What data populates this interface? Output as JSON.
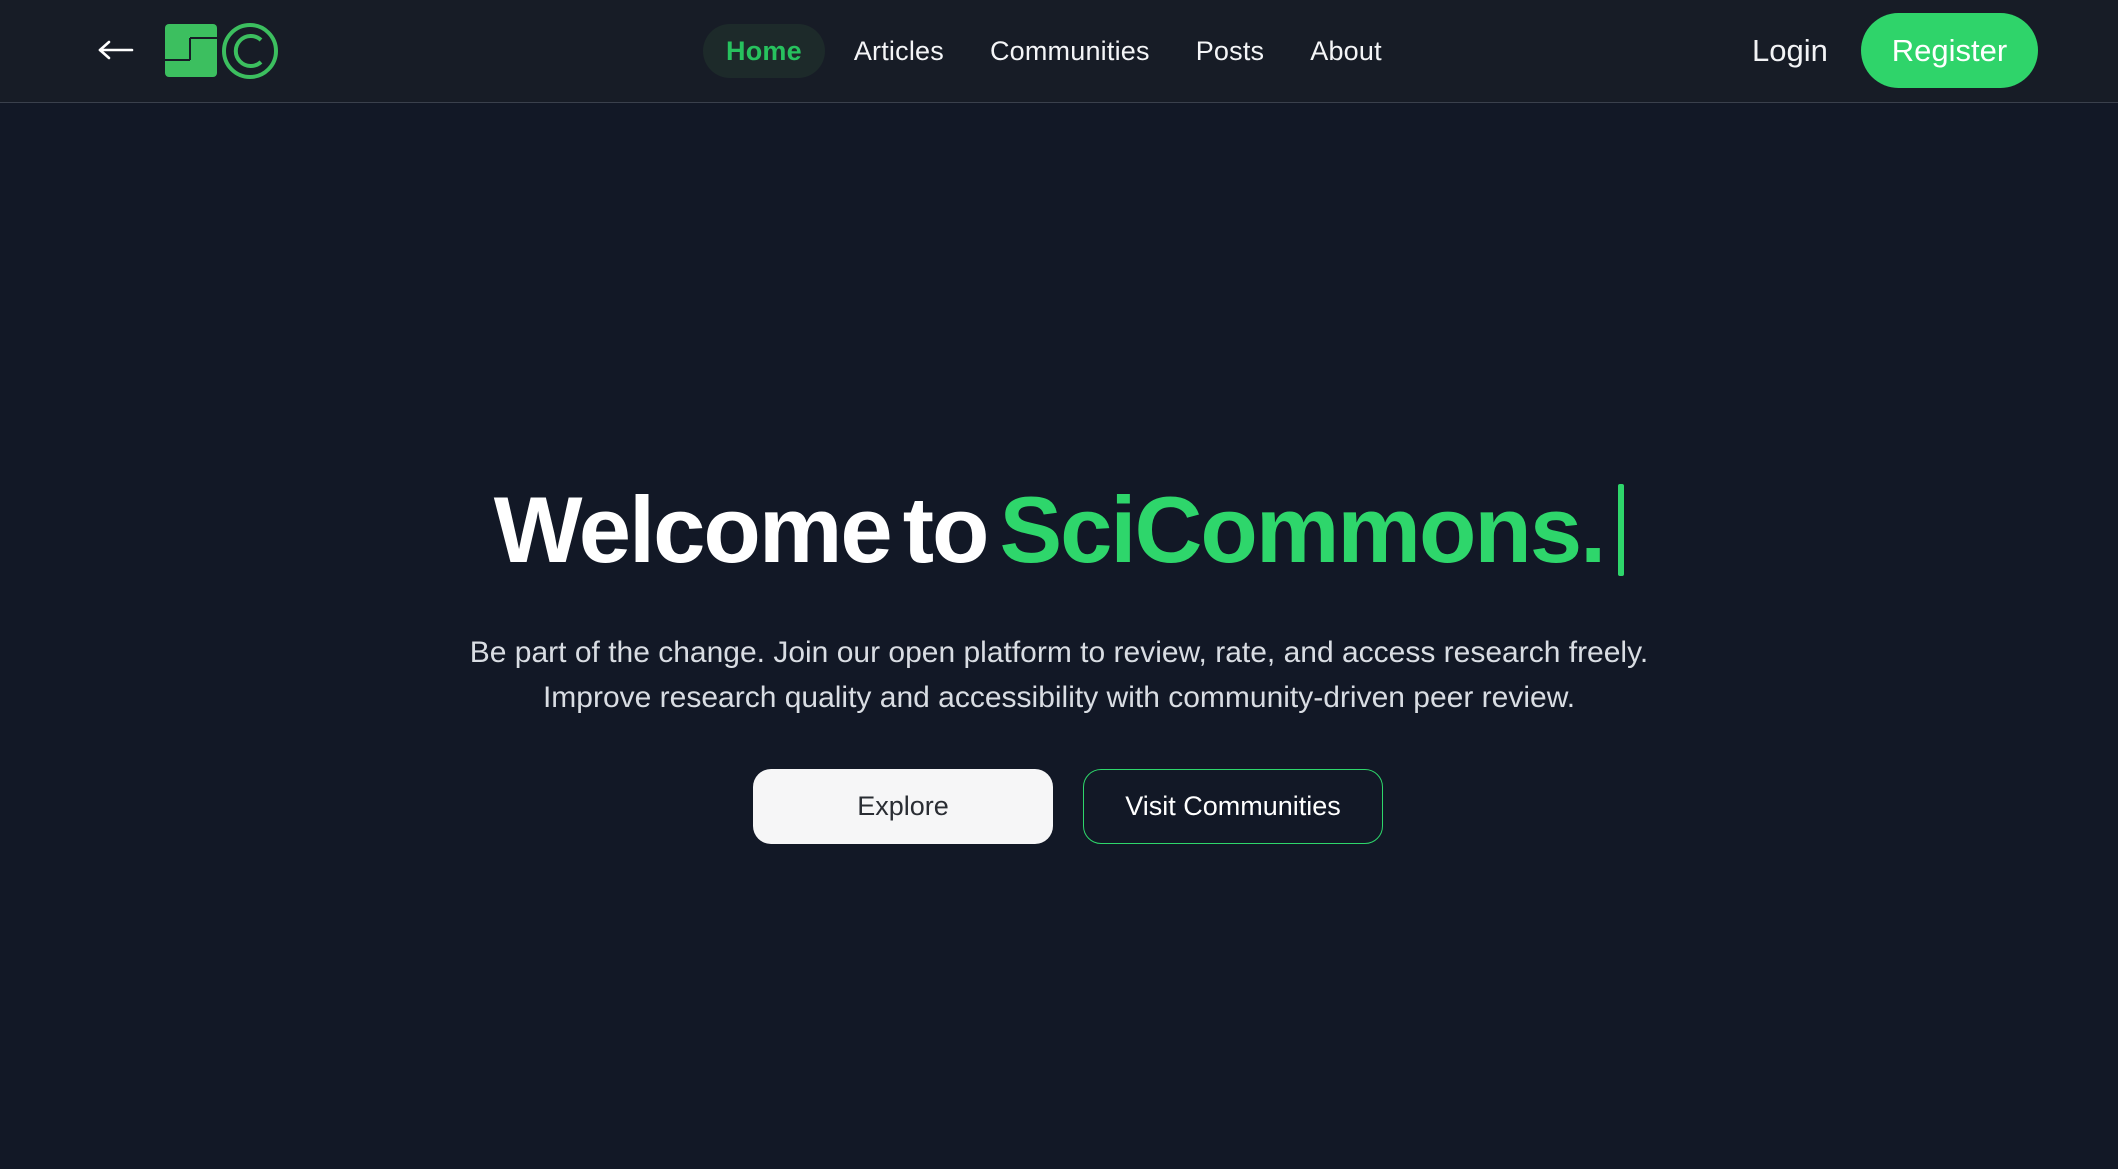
{
  "header": {
    "back_icon": "arrow-left-icon",
    "logo_text": "SC",
    "nav": [
      {
        "label": "Home",
        "active": true
      },
      {
        "label": "Articles",
        "active": false
      },
      {
        "label": "Communities",
        "active": false
      },
      {
        "label": "Posts",
        "active": false
      },
      {
        "label": "About",
        "active": false
      }
    ],
    "login_label": "Login",
    "register_label": "Register"
  },
  "hero": {
    "title_part1": "Welcome",
    "title_part2": "to",
    "title_brand": "SciCommons.",
    "subtitle_line1": "Be part of the change. Join our open platform to review, rate, and access research freely.",
    "subtitle_line2": "Improve research quality and accessibility with community-driven peer review.",
    "explore_label": "Explore",
    "visit_label": "Visit Communities"
  },
  "colors": {
    "brand_green": "#2ed66b",
    "background": "#121826",
    "header_bg": "#171c26"
  }
}
